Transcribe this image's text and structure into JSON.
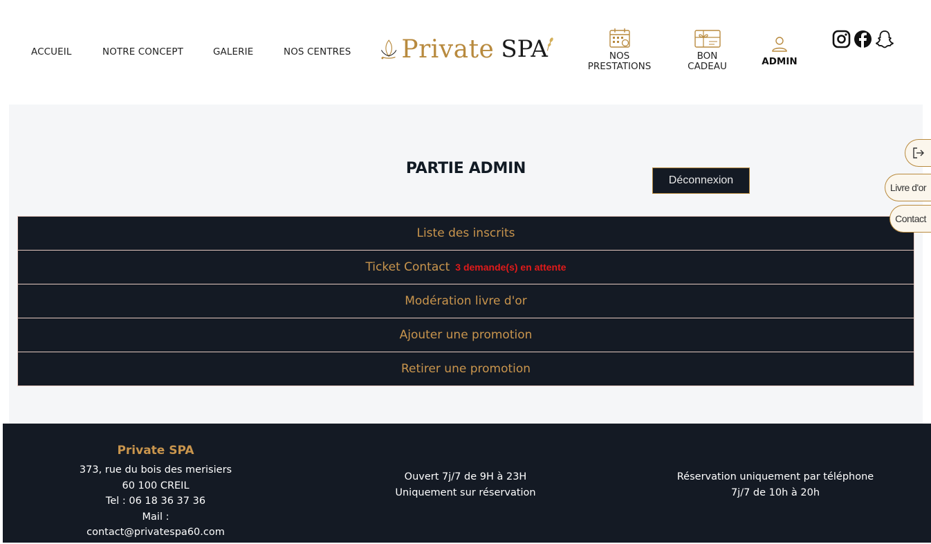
{
  "nav": {
    "accueil": "ACCUEIL",
    "concept": "NOTRE CONCEPT",
    "galerie": "GALERIE",
    "centres": "NOS CENTRES",
    "prestations_line1": "NOS",
    "prestations_line2": "PRESTATIONS",
    "cadeau_line1": "BON",
    "cadeau_line2": "CADEAU",
    "admin": "ADMIN"
  },
  "logo": {
    "word1": "Private",
    "word2": "SPA"
  },
  "admin": {
    "title": "PARTIE ADMIN",
    "logout_label": "Déconnexion",
    "items": [
      {
        "label": "Liste des inscrits"
      },
      {
        "label": "Ticket Contact",
        "pending": "3 demande(s) en attente"
      },
      {
        "label": "Modération livre d'or"
      },
      {
        "label": "Ajouter une promotion"
      },
      {
        "label": "Retirer une promotion"
      }
    ]
  },
  "side_tabs": {
    "livre": "Livre d'or",
    "contact": "Contact"
  },
  "footer": {
    "brand": "Private SPA",
    "address1": "373, rue du bois des merisiers",
    "address2": "60 100 CREIL",
    "tel": "Tel : 06 18 36 37 36",
    "mail": "Mail : contact@privatespa60.com",
    "hours1": "Ouvert 7j/7 de 9H à 23H",
    "hours2": "Uniquement sur réservation",
    "reservation1": "Réservation uniquement par téléphone",
    "reservation2": "7j/7 de 10h à 20h"
  },
  "colors": {
    "gold": "#c9954d",
    "dark": "#141a24",
    "alert": "#e11a1a"
  },
  "icons": [
    "calendar-icon",
    "gift-card-icon",
    "user-icon",
    "instagram-icon",
    "facebook-icon",
    "snapchat-icon",
    "logout-icon",
    "lotus-logo-icon"
  ]
}
